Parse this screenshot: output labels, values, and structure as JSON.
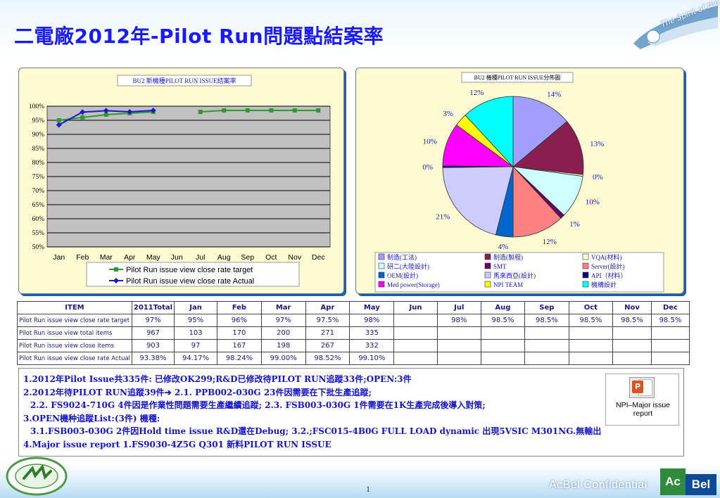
{
  "title": "二電廠2012年-Pilot Run問題點結案率",
  "header_badge": "The Spirit of the Eagle",
  "chart_data": [
    {
      "type": "line",
      "title": "BU2 新機種PILOT RUN ISSUE結案率",
      "categories": [
        "Jan",
        "Feb",
        "Mar",
        "Apr",
        "May",
        "Jun",
        "Jul",
        "Aug",
        "Sep",
        "Oct",
        "Nov",
        "Dec"
      ],
      "ylim": [
        50,
        100
      ],
      "yticks": [
        "50%",
        "55%",
        "60%",
        "65%",
        "70%",
        "75%",
        "80%",
        "85%",
        "90%",
        "95%",
        "100%"
      ],
      "grid": true,
      "legend_position": "bottom",
      "series": [
        {
          "name": "Pilot Run issue view close rate target",
          "color": "#2e9a2e",
          "marker": "square",
          "values": [
            95,
            96,
            97,
            97.5,
            98,
            null,
            98,
            98.5,
            98.5,
            98.5,
            98.5,
            98.5
          ]
        },
        {
          "name": "Pilot Run issue view close rate Actual",
          "color": "#1a1acc",
          "marker": "diamond",
          "values": [
            93.38,
            97.9,
            98.4,
            98,
            98.5,
            null,
            null,
            null,
            null,
            null,
            null,
            null
          ]
        }
      ]
    },
    {
      "type": "pie",
      "title": "BU2 機種PILOT RUN ISSUE分佈圖",
      "legend_position": "bottom",
      "slices": [
        {
          "name": "制造(工法)",
          "value": 14,
          "label": "14%",
          "color": "#9f9fff"
        },
        {
          "name": "制造(製程)",
          "value": 13,
          "label": "13%",
          "color": "#8a1f4f"
        },
        {
          "name": "VQA(材料)",
          "value": 0.4,
          "label": "0%",
          "color": "#ffffcc"
        },
        {
          "name": "研二(大陸設計)",
          "value": 10,
          "label": "10%",
          "color": "#ccffff"
        },
        {
          "name": "SMT",
          "value": 1,
          "label": "1%",
          "color": "#660066"
        },
        {
          "name": "Server(設計)",
          "value": 12,
          "label": "12%",
          "color": "#ff8080"
        },
        {
          "name": "OEM(設計)",
          "value": 4,
          "label": "4%",
          "color": "#0066cc"
        },
        {
          "name": "馬來西亞(設計)",
          "value": 21,
          "label": "21%",
          "color": "#ccccff"
        },
        {
          "name": "API（材料）",
          "value": 0.4,
          "label": "0%",
          "color": "#000080"
        },
        {
          "name": "Med power(Storage)",
          "value": 10,
          "label": "10%",
          "color": "#ff00ff"
        },
        {
          "name": "NPI TEAM",
          "value": 3,
          "label": "3%",
          "color": "#ffff00"
        },
        {
          "name": "機構設計",
          "value": 12,
          "label": "12%",
          "color": "#00ffff"
        }
      ]
    }
  ],
  "table": {
    "headers": [
      "ITEM",
      "2011Total",
      "Jan",
      "Feb",
      "Mar",
      "Apr",
      "May",
      "Jun",
      "Jul",
      "Aug",
      "Sep",
      "Oct",
      "Nov",
      "Dec"
    ],
    "rows": [
      [
        "Pilot Run issue view close rate target",
        "97%",
        "95%",
        "96%",
        "97%",
        "97.5%",
        "98%",
        "",
        "98%",
        "98.5%",
        "98.5%",
        "98.5%",
        "98.5%",
        "98.5%"
      ],
      [
        "Pilot Run issue view  total items",
        "967",
        "103",
        "170",
        "200",
        "271",
        "335",
        "",
        "",
        "",
        "",
        "",
        "",
        ""
      ],
      [
        "Pilot Run issue view close items",
        "903",
        "97",
        "167",
        "198",
        "267",
        "332",
        "",
        "",
        "",
        "",
        "",
        "",
        ""
      ],
      [
        "Pilot Run issue view close rate Actual",
        "93.38%",
        "94.17%",
        "98.24%",
        "99.00%",
        "98.52%",
        "99.10%",
        "",
        "",
        "",
        "",
        "",
        "",
        ""
      ]
    ]
  },
  "notes": [
    "1.2012年Pilot Issue共335件: 已修改OK299;R&D已修改待PILOT RUN追蹤33件;OPEN:3件",
    "2.2012年待PILOT RUN追蹤39件➔  2.1. PPB002-030G 23件因需要在下批生產追蹤;",
    "2.2. FS9024-710G 4件因是作業性問題需要生產繼續追蹤;  2.3. FSB003-030G 1件需要在1K生產完成後導入對策;",
    "3.OPEN機种追蹤List:(3件)  機種:",
    "3.1.FSB003-030G 2件因Hold time issue R&D還在Debug;   3.2.;FSC015-4B0G   FULL LOAD dynamic 出現5VSIC M301NG.無輸出",
    "4.Major issue report   1.FS9030-4Z5G Q301 新料PILOT RUN ISSUE"
  ],
  "attachment_label": "NPI–Major issue report",
  "page_number": "1",
  "footer_text": "AcBel Confidential",
  "brand": {
    "ac": "Ac",
    "bel": "Bel"
  }
}
